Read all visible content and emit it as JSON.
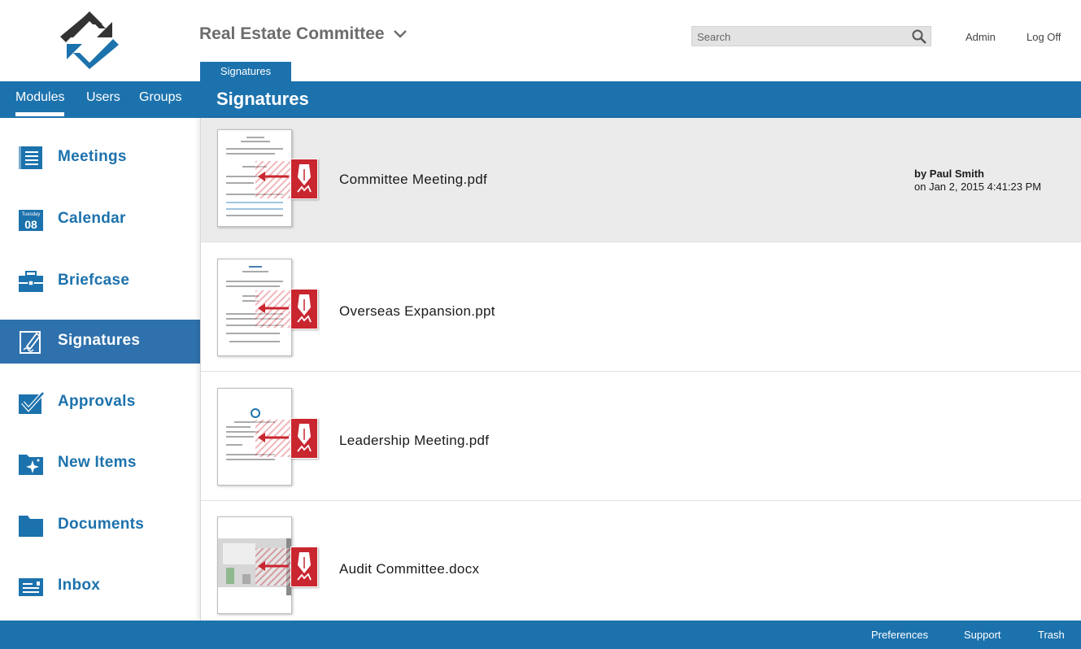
{
  "header": {
    "committee": "Real Estate Committee",
    "search_placeholder": "Search",
    "admin": "Admin",
    "logoff": "Log Off",
    "active_tab": "Signatures"
  },
  "nav": {
    "tabs": [
      "Modules",
      "Users",
      "Groups"
    ]
  },
  "main": {
    "title": "Signatures"
  },
  "sidebar": {
    "items": [
      {
        "label": "Meetings",
        "icon": "meetings-icon"
      },
      {
        "label": "Calendar",
        "icon": "calendar-icon",
        "day": "Tuesday",
        "date": "08"
      },
      {
        "label": "Briefcase",
        "icon": "briefcase-icon"
      },
      {
        "label": "Signatures",
        "icon": "signature-icon",
        "active": true
      },
      {
        "label": "Approvals",
        "icon": "approvals-icon"
      },
      {
        "label": "New Items",
        "icon": "new-items-icon"
      },
      {
        "label": "Documents",
        "icon": "documents-icon"
      },
      {
        "label": "Inbox",
        "icon": "inbox-icon"
      }
    ]
  },
  "documents": [
    {
      "name": "Committee Meeting.pdf",
      "by": "by Paul Smith",
      "on": "on Jan 2, 2015 4:41:23 PM",
      "selected": true
    },
    {
      "name": "Overseas Expansion.ppt"
    },
    {
      "name": "Leadership Meeting.pdf"
    },
    {
      "name": "Audit Committee.docx"
    }
  ],
  "footer": {
    "preferences": "Preferences",
    "support": "Support",
    "trash": "Trash"
  },
  "colors": {
    "brand_blue": "#1c72ad",
    "sign_red": "#c9262f",
    "logo_dark": "#333333"
  }
}
